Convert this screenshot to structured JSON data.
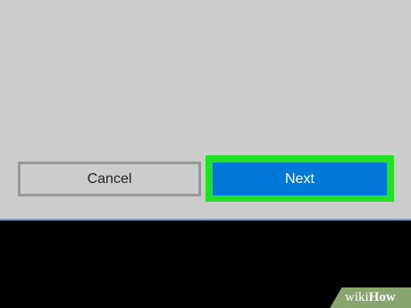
{
  "dialog": {
    "cancel_label": "Cancel",
    "next_label": "Next"
  },
  "watermark": {
    "brand_light": "wiki",
    "brand_bold": "How"
  },
  "colors": {
    "panel_background": "#cccccc",
    "next_button": "#0078d7",
    "highlight": "#22e022",
    "taskbar": "#000000"
  }
}
